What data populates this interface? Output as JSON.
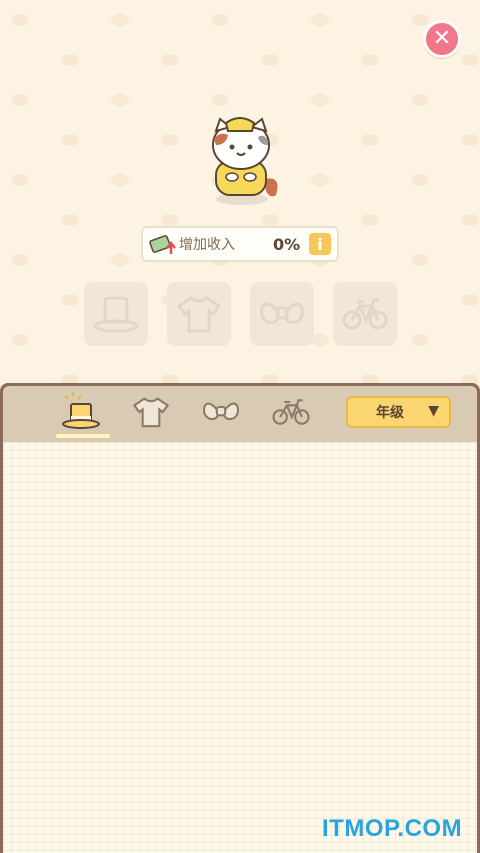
{
  "income": {
    "label": "增加收入",
    "value": "0%",
    "info_icon": "i"
  },
  "slots": [
    {
      "name": "hat-slot",
      "icon": "hat-icon"
    },
    {
      "name": "shirt-slot",
      "icon": "shirt-icon"
    },
    {
      "name": "bow-slot",
      "icon": "bow-icon"
    },
    {
      "name": "bicycle-slot",
      "icon": "bicycle-icon"
    }
  ],
  "tabs": [
    {
      "name": "tab-hat",
      "icon": "hat-icon",
      "active": true
    },
    {
      "name": "tab-shirt",
      "icon": "shirt-icon",
      "active": false
    },
    {
      "name": "tab-bow",
      "icon": "bow-icon",
      "active": false
    },
    {
      "name": "tab-bicycle",
      "icon": "bicycle-icon",
      "active": false
    }
  ],
  "sort": {
    "label": "年级"
  },
  "watermark": "ITMOP.COM",
  "colors": {
    "close": "#f0788a",
    "accent": "#fbd56f",
    "panel": "#8b6b57"
  }
}
